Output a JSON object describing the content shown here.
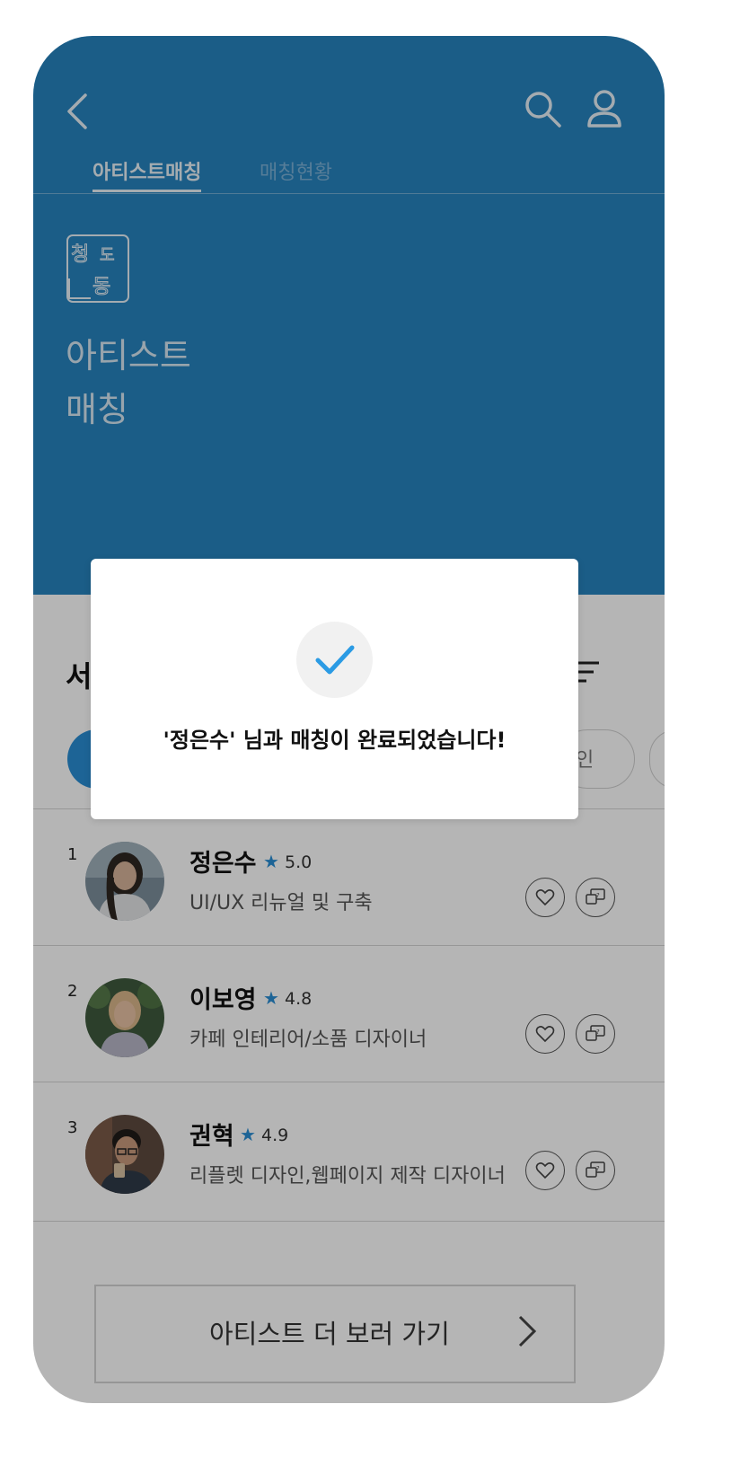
{
  "header": {
    "back_icon": "chevron-left-icon",
    "search_icon": "search-icon",
    "user_icon": "user-icon"
  },
  "tabs": [
    {
      "label": "아티스트매칭",
      "active": true
    },
    {
      "label": "매칭현황",
      "active": false
    }
  ],
  "hero": {
    "logo_text": "청도동",
    "title_line1": "아티스트",
    "title_line2": "매칭"
  },
  "section": {
    "title_partial": "서",
    "chip_partial": "인"
  },
  "artists": [
    {
      "rank": "1",
      "name": "정은수",
      "rating": "5.0",
      "description": "UI/UX 리뉴얼 및 구축"
    },
    {
      "rank": "2",
      "name": "이보영",
      "rating": "4.8",
      "description": "카페 인테리어/소품 디자이너"
    },
    {
      "rank": "3",
      "name": "권혁",
      "rating": "4.9",
      "description": "리플렛 디자인,웹페이지 제작 디자이너"
    }
  ],
  "more_button": {
    "label": "아티스트 더 보러 가기"
  },
  "dialog": {
    "message": "'정은수' 님과 매칭이 완료되었습니다!"
  },
  "colors": {
    "brand_blue": "#2683be",
    "accent_blue": "#2a8ed4",
    "check_blue": "#2b9be4"
  }
}
